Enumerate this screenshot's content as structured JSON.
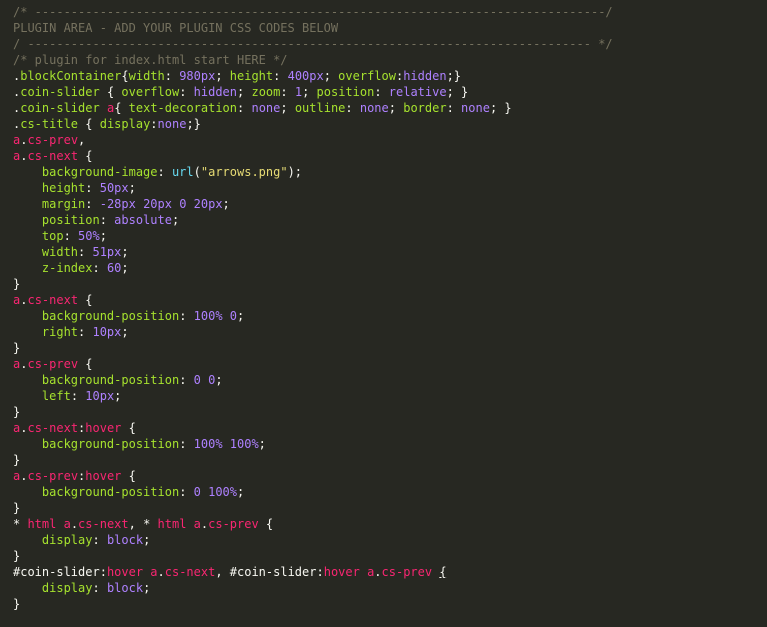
{
  "editor": {
    "lines": [
      [
        {
          "c": "cmt",
          "t": "/* -------------------------------------------------------------------------------/"
        }
      ],
      [
        {
          "c": "cmt",
          "t": "PLUGIN AREA - ADD YOUR PLUGIN CSS CODES BELOW"
        }
      ],
      [
        {
          "c": "cmt",
          "t": "/ ------------------------------------------------------------------------------ */"
        }
      ],
      [
        {
          "c": "cmt",
          "t": "/* plugin for index.html start HERE */"
        }
      ],
      [
        {
          "c": "pun",
          "t": "."
        },
        {
          "c": "cls",
          "t": "blockContainer"
        },
        {
          "c": "pun",
          "t": "{"
        },
        {
          "c": "prop",
          "t": "width"
        },
        {
          "c": "pun",
          "t": ": "
        },
        {
          "c": "num",
          "t": "980px"
        },
        {
          "c": "pun",
          "t": "; "
        },
        {
          "c": "prop",
          "t": "height"
        },
        {
          "c": "pun",
          "t": ": "
        },
        {
          "c": "num",
          "t": "400px"
        },
        {
          "c": "pun",
          "t": "; "
        },
        {
          "c": "prop",
          "t": "overflow"
        },
        {
          "c": "pun",
          "t": ":"
        },
        {
          "c": "val",
          "t": "hidden"
        },
        {
          "c": "pun",
          "t": ";}"
        }
      ],
      [
        {
          "c": "pun",
          "t": "."
        },
        {
          "c": "cls",
          "t": "coin-slider"
        },
        {
          "c": "pun",
          "t": " { "
        },
        {
          "c": "prop",
          "t": "overflow"
        },
        {
          "c": "pun",
          "t": ": "
        },
        {
          "c": "val",
          "t": "hidden"
        },
        {
          "c": "pun",
          "t": "; "
        },
        {
          "c": "prop",
          "t": "zoom"
        },
        {
          "c": "pun",
          "t": ": "
        },
        {
          "c": "num",
          "t": "1"
        },
        {
          "c": "pun",
          "t": "; "
        },
        {
          "c": "prop",
          "t": "position"
        },
        {
          "c": "pun",
          "t": ": "
        },
        {
          "c": "val",
          "t": "relative"
        },
        {
          "c": "pun",
          "t": "; }"
        }
      ],
      [
        {
          "c": "pun",
          "t": "."
        },
        {
          "c": "cls",
          "t": "coin-slider"
        },
        {
          "c": "pun",
          "t": " "
        },
        {
          "c": "sel",
          "t": "a"
        },
        {
          "c": "pun",
          "t": "{ "
        },
        {
          "c": "prop",
          "t": "text-decoration"
        },
        {
          "c": "pun",
          "t": ": "
        },
        {
          "c": "val",
          "t": "none"
        },
        {
          "c": "pun",
          "t": "; "
        },
        {
          "c": "prop",
          "t": "outline"
        },
        {
          "c": "pun",
          "t": ": "
        },
        {
          "c": "val",
          "t": "none"
        },
        {
          "c": "pun",
          "t": "; "
        },
        {
          "c": "prop",
          "t": "border"
        },
        {
          "c": "pun",
          "t": ": "
        },
        {
          "c": "val",
          "t": "none"
        },
        {
          "c": "pun",
          "t": "; }"
        }
      ],
      [
        {
          "c": "pun",
          "t": "."
        },
        {
          "c": "cls",
          "t": "cs-title"
        },
        {
          "c": "pun",
          "t": " { "
        },
        {
          "c": "prop",
          "t": "display"
        },
        {
          "c": "pun",
          "t": ":"
        },
        {
          "c": "val",
          "t": "none"
        },
        {
          "c": "pun",
          "t": ";}"
        }
      ],
      [
        {
          "c": "sel",
          "t": "a"
        },
        {
          "c": "pun",
          "t": "."
        },
        {
          "c": "sel",
          "t": "cs-prev"
        },
        {
          "c": "pun",
          "t": ","
        }
      ],
      [
        {
          "c": "sel",
          "t": "a"
        },
        {
          "c": "pun",
          "t": "."
        },
        {
          "c": "sel",
          "t": "cs-next"
        },
        {
          "c": "pun",
          "t": " {"
        }
      ],
      [
        {
          "c": "pun",
          "t": "    "
        },
        {
          "c": "prop",
          "t": "background-image"
        },
        {
          "c": "pun",
          "t": ": "
        },
        {
          "c": "kw",
          "t": "url"
        },
        {
          "c": "pun",
          "t": "("
        },
        {
          "c": "str",
          "t": "\"arrows.png\""
        },
        {
          "c": "pun",
          "t": ");"
        }
      ],
      [
        {
          "c": "pun",
          "t": "    "
        },
        {
          "c": "prop",
          "t": "height"
        },
        {
          "c": "pun",
          "t": ": "
        },
        {
          "c": "num",
          "t": "50px"
        },
        {
          "c": "pun",
          "t": ";"
        }
      ],
      [
        {
          "c": "pun",
          "t": "    "
        },
        {
          "c": "prop",
          "t": "margin"
        },
        {
          "c": "pun",
          "t": ": "
        },
        {
          "c": "num",
          "t": "-28px 20px 0 20px"
        },
        {
          "c": "pun",
          "t": ";"
        }
      ],
      [
        {
          "c": "pun",
          "t": "    "
        },
        {
          "c": "prop",
          "t": "position"
        },
        {
          "c": "pun",
          "t": ": "
        },
        {
          "c": "val",
          "t": "absolute"
        },
        {
          "c": "pun",
          "t": ";"
        }
      ],
      [
        {
          "c": "pun",
          "t": "    "
        },
        {
          "c": "prop",
          "t": "top"
        },
        {
          "c": "pun",
          "t": ": "
        },
        {
          "c": "num",
          "t": "50%"
        },
        {
          "c": "pun",
          "t": ";"
        }
      ],
      [
        {
          "c": "pun",
          "t": "    "
        },
        {
          "c": "prop",
          "t": "width"
        },
        {
          "c": "pun",
          "t": ": "
        },
        {
          "c": "num",
          "t": "51px"
        },
        {
          "c": "pun",
          "t": ";"
        }
      ],
      [
        {
          "c": "pun",
          "t": "    "
        },
        {
          "c": "prop",
          "t": "z-index"
        },
        {
          "c": "pun",
          "t": ": "
        },
        {
          "c": "num",
          "t": "60"
        },
        {
          "c": "pun",
          "t": ";"
        }
      ],
      [
        {
          "c": "pun",
          "t": "}"
        }
      ],
      [
        {
          "c": "sel",
          "t": "a"
        },
        {
          "c": "pun",
          "t": "."
        },
        {
          "c": "sel",
          "t": "cs-next"
        },
        {
          "c": "pun",
          "t": " {"
        }
      ],
      [
        {
          "c": "pun",
          "t": "    "
        },
        {
          "c": "prop",
          "t": "background-position"
        },
        {
          "c": "pun",
          "t": ": "
        },
        {
          "c": "num",
          "t": "100% 0"
        },
        {
          "c": "pun",
          "t": ";"
        }
      ],
      [
        {
          "c": "pun",
          "t": "    "
        },
        {
          "c": "prop",
          "t": "right"
        },
        {
          "c": "pun",
          "t": ": "
        },
        {
          "c": "num",
          "t": "10px"
        },
        {
          "c": "pun",
          "t": ";"
        }
      ],
      [
        {
          "c": "pun",
          "t": "}"
        }
      ],
      [
        {
          "c": "sel",
          "t": "a"
        },
        {
          "c": "pun",
          "t": "."
        },
        {
          "c": "sel",
          "t": "cs-prev"
        },
        {
          "c": "pun",
          "t": " {"
        }
      ],
      [
        {
          "c": "pun",
          "t": "    "
        },
        {
          "c": "prop",
          "t": "background-position"
        },
        {
          "c": "pun",
          "t": ": "
        },
        {
          "c": "num",
          "t": "0 0"
        },
        {
          "c": "pun",
          "t": ";"
        }
      ],
      [
        {
          "c": "pun",
          "t": "    "
        },
        {
          "c": "prop",
          "t": "left"
        },
        {
          "c": "pun",
          "t": ": "
        },
        {
          "c": "num",
          "t": "10px"
        },
        {
          "c": "pun",
          "t": ";"
        }
      ],
      [
        {
          "c": "pun",
          "t": "}"
        }
      ],
      [
        {
          "c": "sel",
          "t": "a"
        },
        {
          "c": "pun",
          "t": "."
        },
        {
          "c": "sel",
          "t": "cs-next"
        },
        {
          "c": "pun",
          "t": ":"
        },
        {
          "c": "sel",
          "t": "hover"
        },
        {
          "c": "pun",
          "t": " {"
        }
      ],
      [
        {
          "c": "pun",
          "t": "    "
        },
        {
          "c": "prop",
          "t": "background-position"
        },
        {
          "c": "pun",
          "t": ": "
        },
        {
          "c": "num",
          "t": "100% 100%"
        },
        {
          "c": "pun",
          "t": ";"
        }
      ],
      [
        {
          "c": "pun",
          "t": "}"
        }
      ],
      [
        {
          "c": "sel",
          "t": "a"
        },
        {
          "c": "pun",
          "t": "."
        },
        {
          "c": "sel",
          "t": "cs-prev"
        },
        {
          "c": "pun",
          "t": ":"
        },
        {
          "c": "sel",
          "t": "hover"
        },
        {
          "c": "pun",
          "t": " {"
        }
      ],
      [
        {
          "c": "pun",
          "t": "    "
        },
        {
          "c": "prop",
          "t": "background-position"
        },
        {
          "c": "pun",
          "t": ": "
        },
        {
          "c": "num",
          "t": "0 100%"
        },
        {
          "c": "pun",
          "t": ";"
        }
      ],
      [
        {
          "c": "pun",
          "t": "}"
        }
      ],
      [
        {
          "c": "pun",
          "t": "* "
        },
        {
          "c": "sel",
          "t": "html a"
        },
        {
          "c": "pun",
          "t": "."
        },
        {
          "c": "sel",
          "t": "cs-next"
        },
        {
          "c": "pun",
          "t": ", * "
        },
        {
          "c": "sel",
          "t": "html a"
        },
        {
          "c": "pun",
          "t": "."
        },
        {
          "c": "sel",
          "t": "cs-prev"
        },
        {
          "c": "pun",
          "t": " {"
        }
      ],
      [
        {
          "c": "pun",
          "t": "    "
        },
        {
          "c": "prop",
          "t": "display"
        },
        {
          "c": "pun",
          "t": ": "
        },
        {
          "c": "val",
          "t": "block"
        },
        {
          "c": "pun",
          "t": ";"
        }
      ],
      [
        {
          "c": "pun",
          "t": "}"
        }
      ],
      [
        {
          "c": "pun",
          "t": "#coin-slider"
        },
        {
          "c": "pun",
          "t": ":"
        },
        {
          "c": "sel",
          "t": "hover a"
        },
        {
          "c": "pun",
          "t": "."
        },
        {
          "c": "sel",
          "t": "cs-next"
        },
        {
          "c": "pun",
          "t": ", #coin-slider"
        },
        {
          "c": "pun",
          "t": ":"
        },
        {
          "c": "sel",
          "t": "hover a"
        },
        {
          "c": "pun",
          "t": "."
        },
        {
          "c": "sel",
          "t": "cs-prev"
        },
        {
          "c": "pun",
          "t": " "
        },
        {
          "c": "caret",
          "t": "{"
        }
      ],
      [
        {
          "c": "pun",
          "t": "    "
        },
        {
          "c": "prop",
          "t": "display"
        },
        {
          "c": "pun",
          "t": ": "
        },
        {
          "c": "val",
          "t": "block"
        },
        {
          "c": "pun",
          "t": ";"
        }
      ],
      [
        {
          "c": "pun",
          "t": "}"
        }
      ]
    ]
  }
}
